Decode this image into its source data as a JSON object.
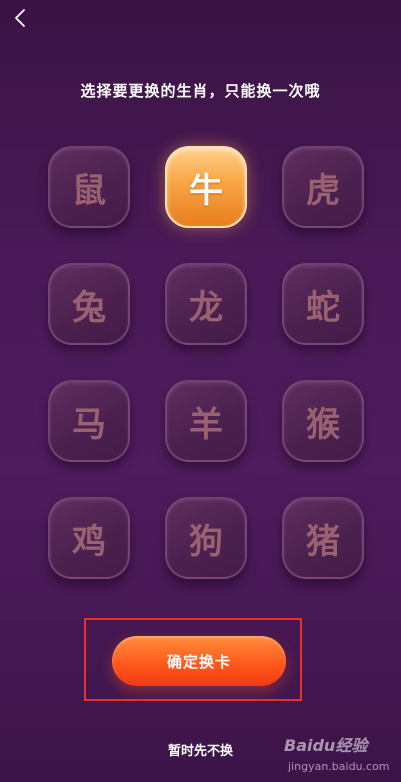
{
  "header": {
    "back_icon": "chevron-left-icon",
    "title": "选择要更换的生肖，只能换一次哦"
  },
  "zodiac": {
    "selected_index": 1,
    "items": [
      {
        "label": "鼠"
      },
      {
        "label": "牛"
      },
      {
        "label": "虎"
      },
      {
        "label": "兔"
      },
      {
        "label": "龙"
      },
      {
        "label": "蛇"
      },
      {
        "label": "马"
      },
      {
        "label": "羊"
      },
      {
        "label": "猴"
      },
      {
        "label": "鸡"
      },
      {
        "label": "狗"
      },
      {
        "label": "猪"
      }
    ]
  },
  "actions": {
    "confirm_label": "确定换卡",
    "skip_label": "暂时先不换"
  },
  "watermark": {
    "logo_text": "Baidu经验",
    "site_text": "jingyan.baidu.com"
  },
  "colors": {
    "background": "#4a1a58",
    "selected_card": "#f8a544",
    "confirm_button": "#ff5a1e",
    "highlight_box": "#e8312c"
  }
}
